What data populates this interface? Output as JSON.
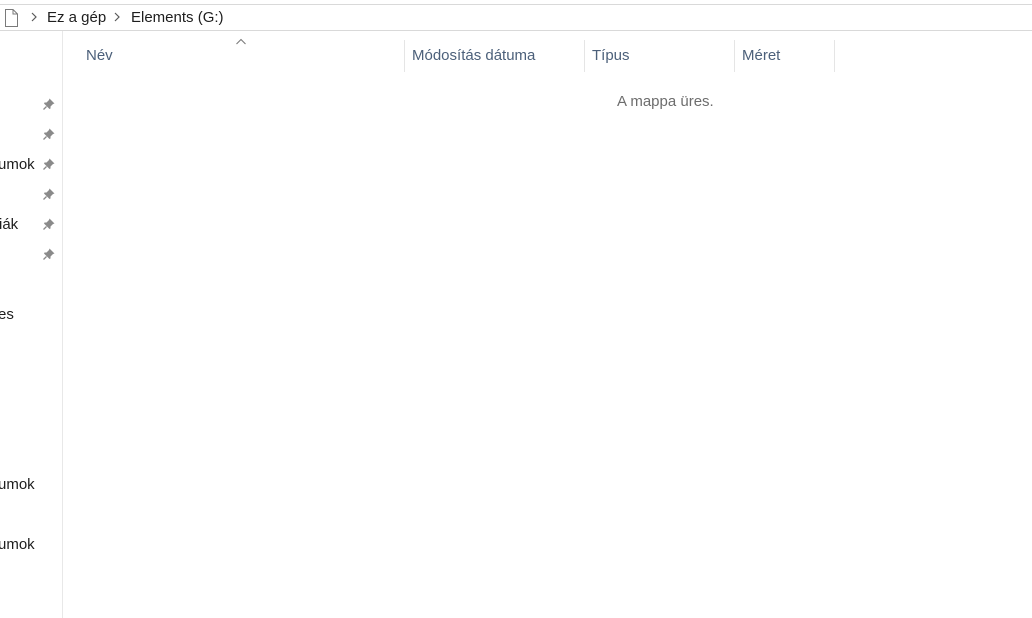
{
  "address_bar": {
    "crumbs": [
      "Ez a gép",
      "Elements (G:)"
    ]
  },
  "nav_pane": {
    "items": [
      {
        "label": "",
        "pinned": true
      },
      {
        "label": "",
        "pinned": true
      },
      {
        "label": "umok",
        "pinned": true
      },
      {
        "label": "",
        "pinned": true
      },
      {
        "label": "iák",
        "pinned": true
      },
      {
        "label": "",
        "pinned": true
      },
      {
        "label": "es",
        "pinned": false
      },
      {
        "label": "umok",
        "pinned": false
      },
      {
        "label": "umok",
        "pinned": false
      }
    ]
  },
  "columns": {
    "name": "Név",
    "modified": "Módosítás dátuma",
    "type": "Típus",
    "size": "Méret"
  },
  "content": {
    "empty_message": "A mappa üres."
  }
}
